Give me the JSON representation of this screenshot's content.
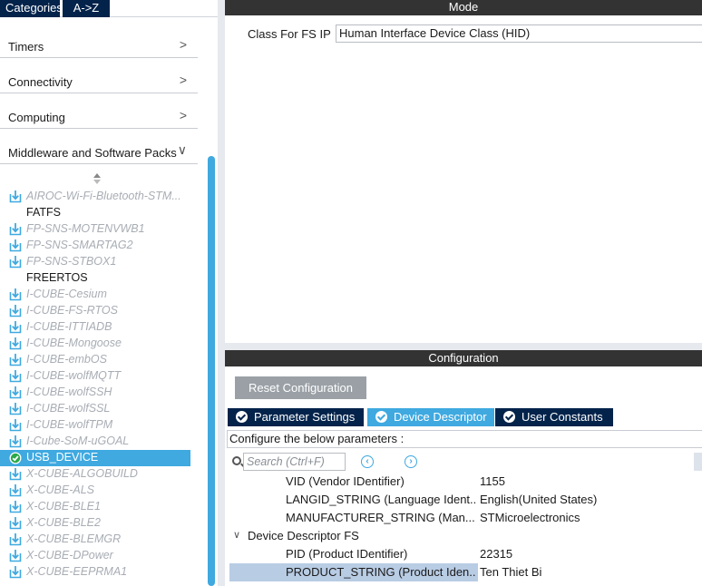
{
  "left_tabs": {
    "categories": "Categories",
    "az": "A->Z"
  },
  "categories": [
    {
      "label": "Timers",
      "chevron": ">"
    },
    {
      "label": "Connectivity",
      "chevron": ">"
    },
    {
      "label": "Computing",
      "chevron": ">"
    },
    {
      "label": "Middleware and Software Packs",
      "chevron": "∨"
    }
  ],
  "packs": [
    {
      "label": "AIROC-Wi-Fi-Bluetooth-STM...",
      "kind": "pack"
    },
    {
      "label": "FATFS",
      "kind": "plain"
    },
    {
      "label": "FP-SNS-MOTENVWB1",
      "kind": "pack"
    },
    {
      "label": "FP-SNS-SMARTAG2",
      "kind": "pack"
    },
    {
      "label": "FP-SNS-STBOX1",
      "kind": "pack"
    },
    {
      "label": "FREERTOS",
      "kind": "plain"
    },
    {
      "label": "I-CUBE-Cesium",
      "kind": "pack"
    },
    {
      "label": "I-CUBE-FS-RTOS",
      "kind": "pack"
    },
    {
      "label": "I-CUBE-ITTIADB",
      "kind": "pack"
    },
    {
      "label": "I-CUBE-Mongoose",
      "kind": "pack"
    },
    {
      "label": "I-CUBE-embOS",
      "kind": "pack"
    },
    {
      "label": "I-CUBE-wolfMQTT",
      "kind": "pack"
    },
    {
      "label": "I-CUBE-wolfSSH",
      "kind": "pack"
    },
    {
      "label": "I-CUBE-wolfSSL",
      "kind": "pack"
    },
    {
      "label": "I-CUBE-wolfTPM",
      "kind": "pack"
    },
    {
      "label": "I-Cube-SoM-uGOAL",
      "kind": "pack"
    },
    {
      "label": "USB_DEVICE",
      "kind": "selected"
    },
    {
      "label": "X-CUBE-ALGOBUILD",
      "kind": "pack"
    },
    {
      "label": "X-CUBE-ALS",
      "kind": "pack"
    },
    {
      "label": "X-CUBE-BLE1",
      "kind": "pack"
    },
    {
      "label": "X-CUBE-BLE2",
      "kind": "pack"
    },
    {
      "label": "X-CUBE-BLEMGR",
      "kind": "pack"
    },
    {
      "label": "X-CUBE-DPower",
      "kind": "pack"
    },
    {
      "label": "X-CUBE-EEPRMA1",
      "kind": "pack"
    }
  ],
  "mode": {
    "title": "Mode",
    "class_label": "Class For FS IP",
    "class_value": "Human Interface Device Class (HID)"
  },
  "config": {
    "title": "Configuration",
    "reset_label": "Reset Configuration",
    "tabs": [
      "Parameter Settings",
      "Device Descriptor",
      "User Constants"
    ],
    "active_tab": "Device Descriptor",
    "hint": "Configure the below parameters :",
    "search_placeholder": "Search (Ctrl+F)",
    "rows_before": [
      {
        "name": "VID (Vendor IDentifier)",
        "value": "1155"
      },
      {
        "name": "LANGID_STRING (Language Ident...",
        "value": "English(United States)"
      },
      {
        "name": "MANUFACTURER_STRING (Man...",
        "value": "STMicroelectronics"
      }
    ],
    "group": "Device Descriptor FS",
    "rows_after": [
      {
        "name": "PID (Product IDentifier)",
        "value": "22315",
        "selected": false
      },
      {
        "name": "PRODUCT_STRING (Product Iden...",
        "value": "Ten Thiet Bi",
        "selected": true
      }
    ]
  },
  "colors": {
    "accent": "#3fa9e0",
    "dark_tab": "#03234b",
    "header": "#333333",
    "disabled_text": "#a8adb4",
    "selected_row": "#b8cce4"
  }
}
